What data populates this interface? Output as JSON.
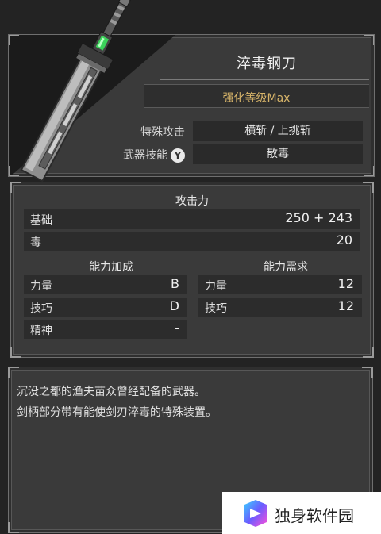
{
  "weapon": {
    "name": "淬毒钢刀",
    "upgrade": "强化等级Max",
    "special_attack_label": "特殊攻击",
    "special_attack_value": "横斩 / 上挑斩",
    "skill_label": "武器技能",
    "skill_button": "Y",
    "skill_value": "散毒"
  },
  "attack": {
    "title": "攻击力",
    "rows": [
      {
        "label": "基础",
        "value": "250 + 243"
      },
      {
        "label": "毒",
        "value": "20"
      }
    ]
  },
  "scaling": {
    "title": "能力加成",
    "rows": [
      {
        "label": "力量",
        "value": "B"
      },
      {
        "label": "技巧",
        "value": "D"
      },
      {
        "label": "精神",
        "value": "-"
      }
    ]
  },
  "requirement": {
    "title": "能力需求",
    "rows": [
      {
        "label": "力量",
        "value": "12"
      },
      {
        "label": "技巧",
        "value": "12"
      }
    ]
  },
  "description": {
    "lines": [
      "沉没之都的渔夫苗众曾经配备的武器。",
      "剑柄部分带有能使剑刃淬毒的特殊装置。"
    ]
  },
  "watermark": {
    "text": "独身软件园",
    "icon": "app-logo-icon"
  },
  "colors": {
    "upgrade": "#d8b56a",
    "accent_green": "#3bd25a"
  }
}
